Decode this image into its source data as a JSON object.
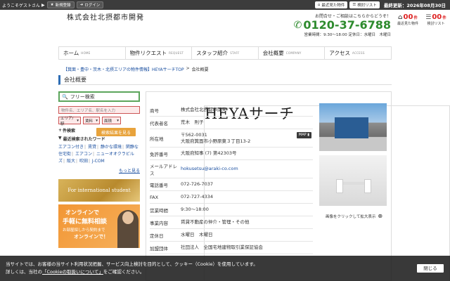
{
  "topbar": {
    "greeting": "ようこそゲストさん",
    "register_label": "新規登録",
    "login_label": "ログイン",
    "recent_label": "最近見た物件",
    "review_label": "検討リスト",
    "updated": "最終更新：2026年08月30日"
  },
  "header": {
    "logo_main": "HEYAサーチ",
    "logo_sub": "株式会社北摂都市開発",
    "contact_lead": "お問合せ・ご相談はこちらからどうぞ！",
    "tel": "0120-37-6788",
    "hours": "営業時間：9:30〜18:00 定休日：水曜日　木曜日"
  },
  "counters": [
    {
      "num": "00",
      "unit": "件",
      "label": "最近見た物件"
    },
    {
      "num": "00",
      "unit": "件",
      "label": "検討リスト"
    }
  ],
  "nav": [
    {
      "jp": "ホーム",
      "en": "HOME"
    },
    {
      "jp": "物件リクエスト",
      "en": "REQUEST"
    },
    {
      "jp": "スタッフ紹介",
      "en": "STAFF"
    },
    {
      "jp": "会社概要",
      "en": "COMPANY"
    },
    {
      "jp": "アクセス",
      "en": "ACCESS"
    }
  ],
  "breadcrumb": {
    "link": "【箕面・豊中・茨木・北摂エリアの物件情報】HEYAサーチTOP",
    "sep": ">",
    "current": "会社概要"
  },
  "page_title": "会社概要",
  "sidebar": {
    "free_search": "フリー検索",
    "input_placeholder": "物件名、エリア名、駅名を入力",
    "selects": [
      "エリア/駅",
      "賃料",
      "面積"
    ],
    "search_cond": "件検索",
    "find_button": "検索結果を見る",
    "recent_head": "最近検索されたワード",
    "recent_words": [
      "エアコン付き",
      "賃貸",
      "静かな環境",
      "閑静な住宅街",
      "エアコン",
      "ニューオオクラビルズ",
      "阪大",
      "吹田",
      "J-COM"
    ],
    "more": "もっと見る",
    "banner_intl": "For international student",
    "banner_online": {
      "t1": "オンラインで",
      "t2": "手軽に無料相談",
      "t3": "お部屋探しから契約まで",
      "t4": "オンラインで！"
    }
  },
  "company": [
    {
      "key": "商号",
      "value": "株式会社北摂都市開発"
    },
    {
      "key": "代表者名",
      "value": "荒木　則子"
    },
    {
      "key": "所在地",
      "value": "〒562-0031\n大阪府箕面市小野原東３丁目13-2",
      "map": "MAP"
    },
    {
      "key": "免許番号",
      "value": "大阪府知事 (7) 第42303号"
    },
    {
      "key": "メールアドレス",
      "value": "hokusetsu@araki-co.com"
    },
    {
      "key": "電話番号",
      "value": "072-726-7037"
    },
    {
      "key": "FAX",
      "value": "072-727-4334"
    },
    {
      "key": "営業時間",
      "value": "9:30〜18:00"
    },
    {
      "key": "事業内容",
      "value": "賃貸不動産の仲介・管理・その他"
    },
    {
      "key": "定休日",
      "value": "水曜日　木曜日"
    },
    {
      "key": "加盟団体",
      "value": "社団法人　全国宅地建物取引業保証協会"
    }
  ],
  "photo_caption": "画像をクリックして拡大表示",
  "cookie": {
    "line1": "当サイトでは、お客様の当サイト利用状況把握、サービス向上検討を目的として、クッキー（Cookie）を使用しています。",
    "line2_pre": "詳しくは、当社の",
    "line2_link": "「Cookieの取扱いについて」",
    "line2_post": "をご確認ください。",
    "close": "閉じる"
  },
  "colors": {
    "topbar": "#3c3c3c",
    "accent_green": "#2e8b2e",
    "link_blue": "#1a4fa0",
    "find_button": "#e8a33c"
  }
}
